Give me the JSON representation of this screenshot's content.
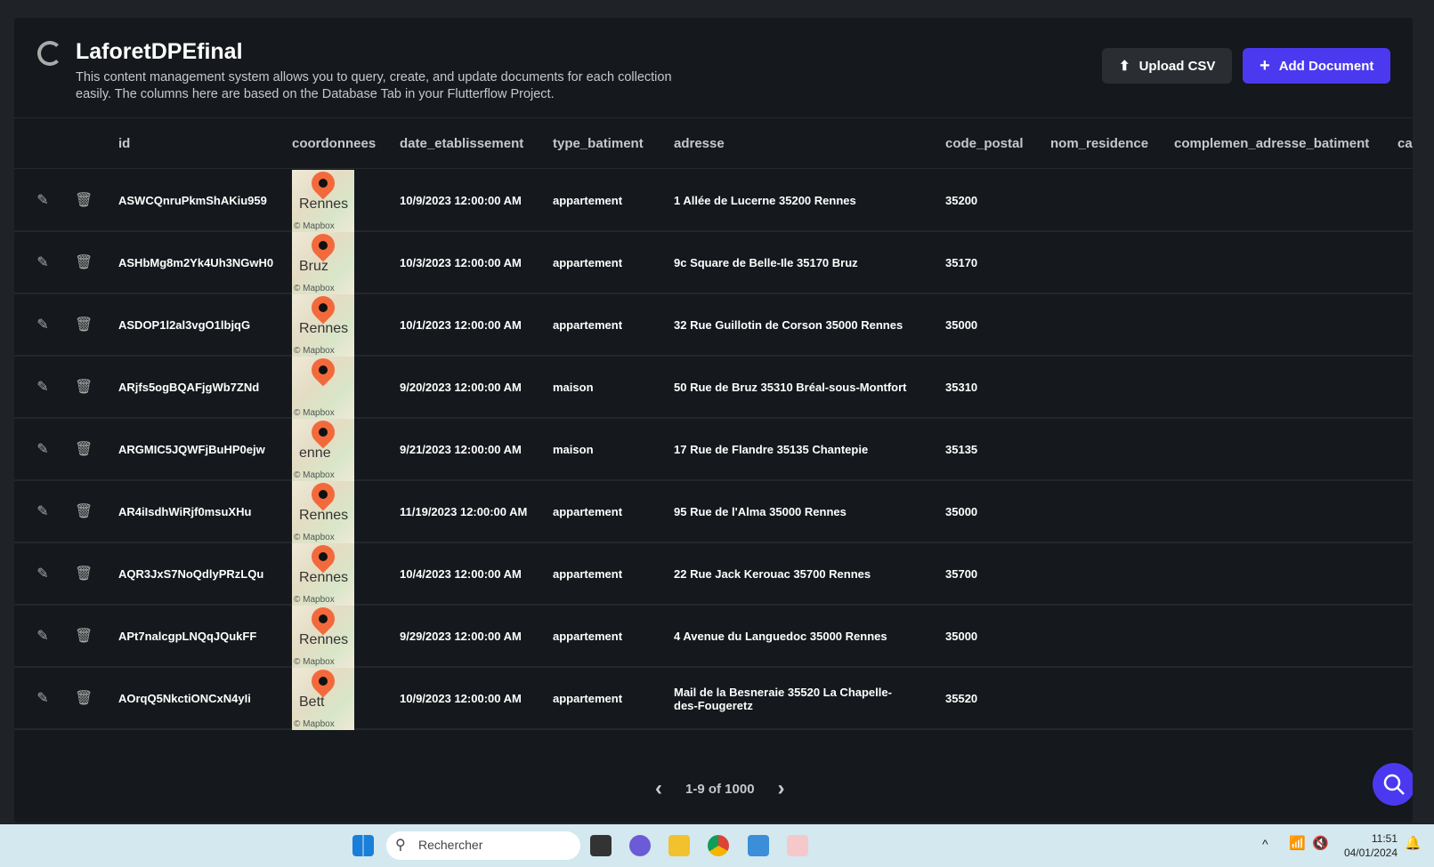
{
  "header": {
    "title": "LaforetDPEfinal",
    "description": "This content management system allows you to query, create, and update documents for each collection easily. The columns here are based on the Database Tab in your Flutterflow Project.",
    "upload_label": "Upload CSV",
    "add_label": "Add Document"
  },
  "columns": [
    "id",
    "coordonnees",
    "date_etablissement",
    "type_batiment",
    "adresse",
    "code_postal",
    "nom_residence",
    "complemen_adresse_batiment",
    "ca"
  ],
  "rows": [
    {
      "id": "ASWCQnruPkmShAKiu959",
      "map_label": "Rennes",
      "date": "10/9/2023 12:00:00 AM",
      "type": "appartement",
      "adresse": "1 Allée de Lucerne 35200 Rennes",
      "code": "35200"
    },
    {
      "id": "ASHbMg8m2Yk4Uh3NGwH0",
      "map_label": "Bruz",
      "date": "10/3/2023 12:00:00 AM",
      "type": "appartement",
      "adresse": "9c Square de Belle-Ile 35170 Bruz",
      "code": "35170"
    },
    {
      "id": "ASDOP1l2al3vgO1lbjqG",
      "map_label": "Rennes",
      "date": "10/1/2023 12:00:00 AM",
      "type": "appartement",
      "adresse": "32 Rue Guillotin de Corson 35000 Rennes",
      "code": "35000"
    },
    {
      "id": "ARjfs5ogBQAFjgWb7ZNd",
      "map_label": "",
      "date": "9/20/2023 12:00:00 AM",
      "type": "maison",
      "adresse": "50 Rue de Bruz 35310 Bréal-sous-Montfort",
      "code": "35310"
    },
    {
      "id": "ARGMIC5JQWFjBuHP0ejw",
      "map_label": "enne",
      "date": "9/21/2023 12:00:00 AM",
      "type": "maison",
      "adresse": "17 Rue de Flandre 35135 Chantepie",
      "code": "35135"
    },
    {
      "id": "AR4iIsdhWiRjf0msuXHu",
      "map_label": "Rennes",
      "date": "11/19/2023 12:00:00 AM",
      "type": "appartement",
      "adresse": "95 Rue de l'Alma 35000 Rennes",
      "code": "35000"
    },
    {
      "id": "AQR3JxS7NoQdlyPRzLQu",
      "map_label": "Rennes",
      "date": "10/4/2023 12:00:00 AM",
      "type": "appartement",
      "adresse": "22 Rue Jack Kerouac 35700 Rennes",
      "code": "35700"
    },
    {
      "id": "APt7nalcgpLNQqJQukFF",
      "map_label": "Rennes",
      "date": "9/29/2023 12:00:00 AM",
      "type": "appartement",
      "adresse": "4 Avenue du Languedoc 35000 Rennes",
      "code": "35000"
    },
    {
      "id": "AOrqQ5NkctiONCxN4yIi",
      "map_label": "Bett",
      "date": "10/9/2023 12:00:00 AM",
      "type": "appartement",
      "adresse": "Mail de la Besneraie 35520 La Chapelle-des-Fougeretz",
      "code": "35520"
    }
  ],
  "map_attribution": "© Mapbox",
  "pagination": {
    "label": "1-9 of 1000"
  },
  "taskbar": {
    "search_placeholder": "Rechercher",
    "time": "11:51",
    "date": "04/01/2024"
  },
  "colors": {
    "accent": "#4b39ef",
    "pin": "#f26a3c"
  }
}
